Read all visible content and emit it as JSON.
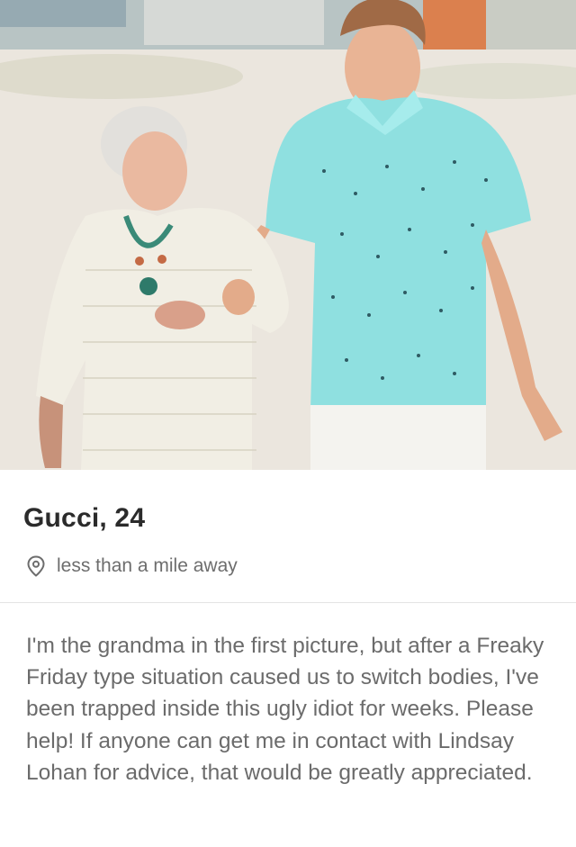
{
  "profile": {
    "name_age": "Gucci, 24",
    "distance": "less than a mile away",
    "bio": "I'm the grandma in the first picture, but after a Freaky Friday type situation caused us to switch bodies, I've been trapped inside this ugly idiot for weeks. Please help! If anyone can get me in contact with Lindsay Lohan for advice, that would be greatly appreciated.",
    "photo_icon": "profile-photo"
  },
  "icons": {
    "location": "location-pin-icon"
  },
  "colors": {
    "name_text": "#2b2b2b",
    "secondary_text": "#6d6d6d",
    "divider": "#e3e3e3",
    "shirt": "#8fe0e0"
  }
}
